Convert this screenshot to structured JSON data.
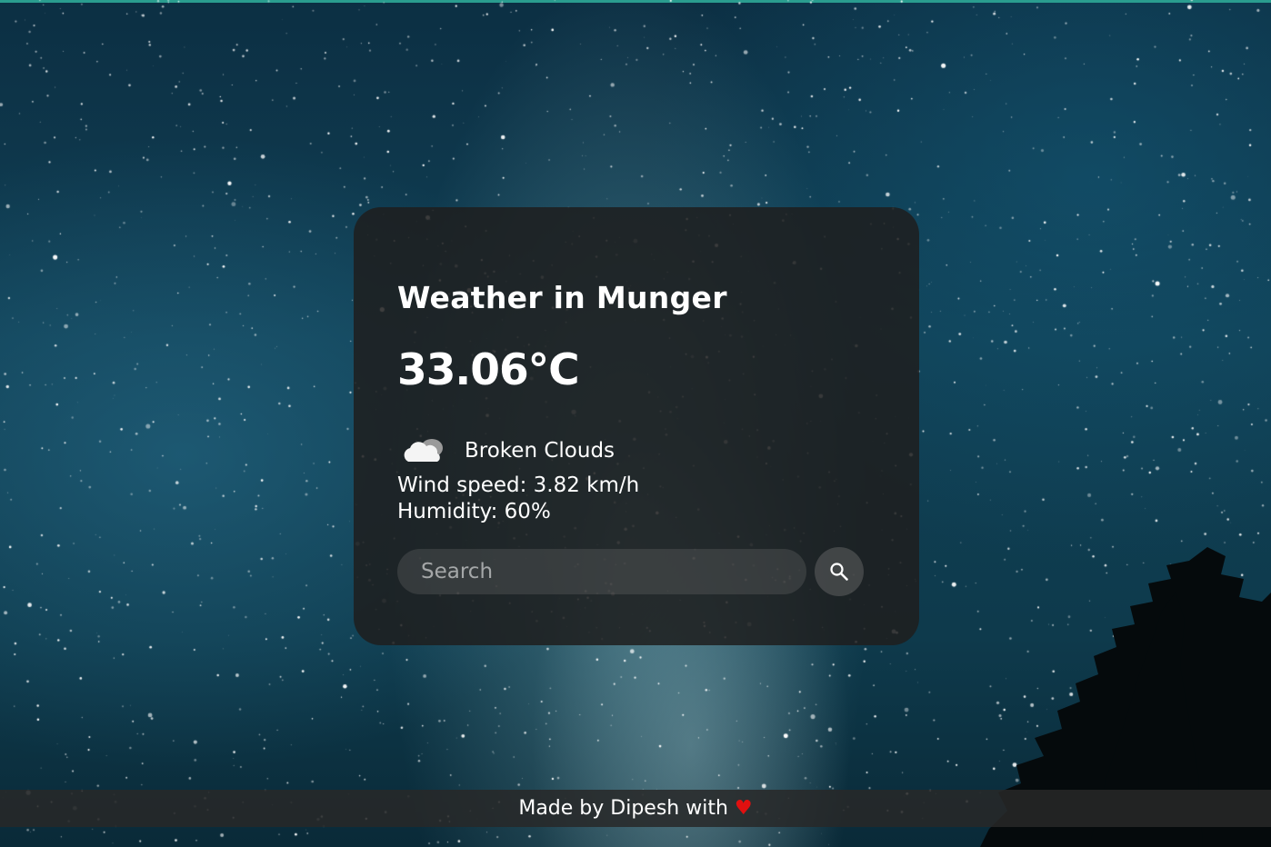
{
  "weather": {
    "title": "Weather in Munger",
    "temperature": "33.06°C",
    "description": "Broken Clouds",
    "icon": "cloud-icon",
    "wind": "Wind speed: 3.82 km/h",
    "humidity": "Humidity: 60%"
  },
  "search": {
    "placeholder": "Search",
    "button_icon": "search-icon"
  },
  "footer": {
    "text": "Made by Dipesh with",
    "heart_icon": "♥",
    "heart_color": "#e01010"
  },
  "colors": {
    "card_background": "#1e1e1e",
    "text": "#ffffff",
    "top_strip": "#2a9d8f"
  }
}
